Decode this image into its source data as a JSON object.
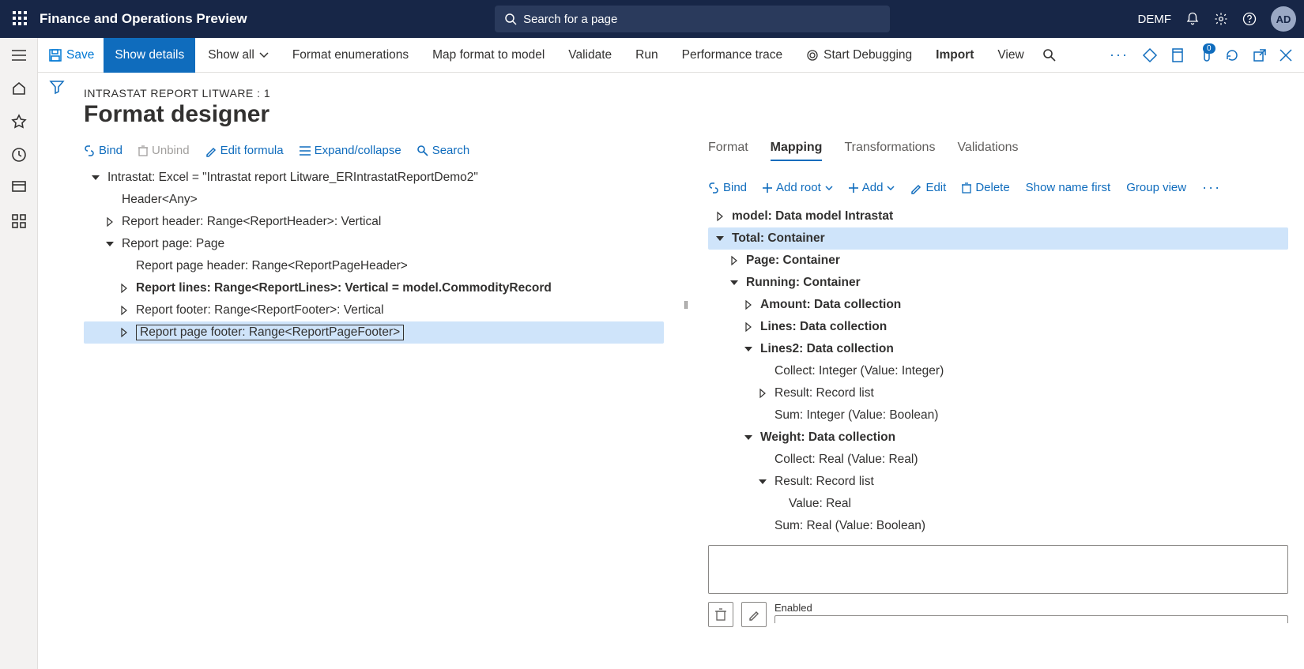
{
  "topbar": {
    "title": "Finance and Operations Preview",
    "search_placeholder": "Search for a page",
    "company": "DEMF",
    "avatar_initials": "AD"
  },
  "actionbar": {
    "save": "Save",
    "show_details": "Show details",
    "show_all": "Show all",
    "format_enum": "Format enumerations",
    "map_format": "Map format to model",
    "validate": "Validate",
    "run": "Run",
    "perf_trace": "Performance trace",
    "start_debug": "Start Debugging",
    "import": "Import",
    "view": "View",
    "badge": "0"
  },
  "header": {
    "crumb": "INTRASTAT REPORT LITWARE : 1",
    "title": "Format designer"
  },
  "left_toolbar": {
    "bind": "Bind",
    "unbind": "Unbind",
    "edit_formula": "Edit formula",
    "expand": "Expand/collapse",
    "search": "Search"
  },
  "left_tree": [
    {
      "depth": 0,
      "caret": "down",
      "bold": false,
      "text": "Intrastat: Excel = \"Intrastat report Litware_ERIntrastatReportDemo2\""
    },
    {
      "depth": 1,
      "caret": "",
      "bold": false,
      "text": "Header<Any>"
    },
    {
      "depth": 1,
      "caret": "right",
      "bold": false,
      "text": "Report header: Range<ReportHeader>: Vertical"
    },
    {
      "depth": 1,
      "caret": "down",
      "bold": false,
      "text": "Report page: Page"
    },
    {
      "depth": 2,
      "caret": "",
      "bold": false,
      "text": "Report page header: Range<ReportPageHeader>"
    },
    {
      "depth": 2,
      "caret": "right",
      "bold": true,
      "text": "Report lines: Range<ReportLines>: Vertical = model.CommodityRecord"
    },
    {
      "depth": 2,
      "caret": "right",
      "bold": false,
      "text": "Report footer: Range<ReportFooter>: Vertical"
    },
    {
      "depth": 2,
      "caret": "right",
      "bold": false,
      "text": "Report page footer: Range<ReportPageFooter>",
      "selected": true,
      "boxed": true
    }
  ],
  "right_tabs": {
    "format": "Format",
    "mapping": "Mapping",
    "transformations": "Transformations",
    "validations": "Validations"
  },
  "right_toolbar": {
    "bind": "Bind",
    "add_root": "Add root",
    "add": "Add",
    "edit": "Edit",
    "delete": "Delete",
    "show_name_first": "Show name first",
    "group_view": "Group view"
  },
  "right_tree": [
    {
      "depth": 0,
      "caret": "right",
      "bold": true,
      "text": "model: Data model Intrastat"
    },
    {
      "depth": 0,
      "caret": "down",
      "bold": true,
      "text": "Total: Container",
      "hl": true
    },
    {
      "depth": 1,
      "caret": "right",
      "bold": true,
      "text": "Page: Container"
    },
    {
      "depth": 1,
      "caret": "down",
      "bold": true,
      "text": "Running: Container"
    },
    {
      "depth": 2,
      "caret": "right",
      "bold": true,
      "text": "Amount: Data collection"
    },
    {
      "depth": 2,
      "caret": "right",
      "bold": true,
      "text": "Lines: Data collection"
    },
    {
      "depth": 2,
      "caret": "down",
      "bold": true,
      "text": "Lines2: Data collection"
    },
    {
      "depth": 3,
      "caret": "",
      "bold": false,
      "text": "Collect: Integer (Value: Integer)"
    },
    {
      "depth": 3,
      "caret": "right",
      "bold": false,
      "text": "Result: Record list"
    },
    {
      "depth": 3,
      "caret": "",
      "bold": false,
      "text": "Sum: Integer (Value: Boolean)"
    },
    {
      "depth": 2,
      "caret": "down",
      "bold": true,
      "text": "Weight: Data collection"
    },
    {
      "depth": 3,
      "caret": "",
      "bold": false,
      "text": "Collect: Real (Value: Real)"
    },
    {
      "depth": 3,
      "caret": "down",
      "bold": false,
      "text": "Result: Record list"
    },
    {
      "depth": 4,
      "caret": "",
      "bold": false,
      "text": "Value: Real"
    },
    {
      "depth": 3,
      "caret": "",
      "bold": false,
      "text": "Sum: Real (Value: Boolean)"
    }
  ],
  "detail": {
    "enabled_label": "Enabled"
  }
}
